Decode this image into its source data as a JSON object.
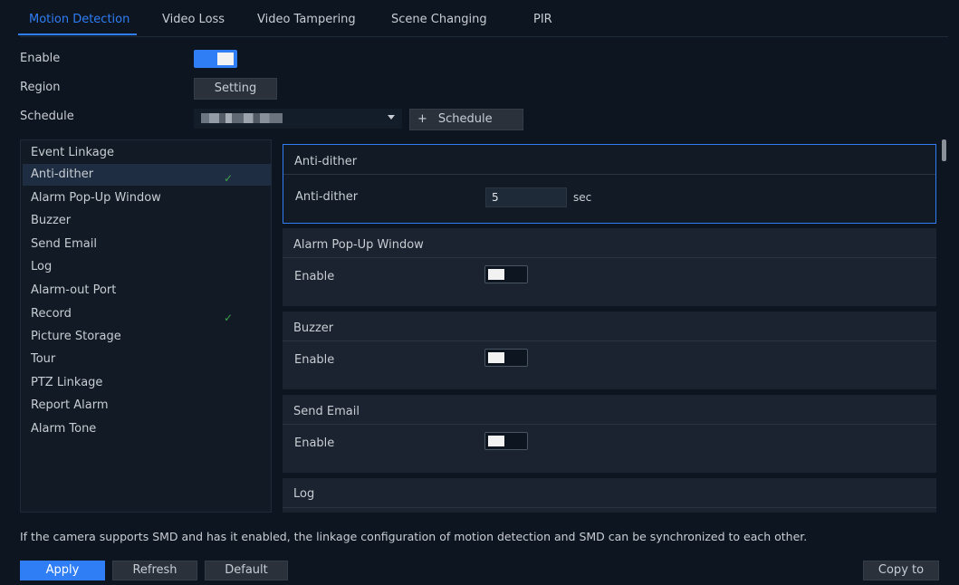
{
  "tabs": [
    {
      "label": "Motion Detection"
    },
    {
      "label": "Video Loss"
    },
    {
      "label": "Video Tampering"
    },
    {
      "label": "Scene Changing"
    },
    {
      "label": "PIR"
    }
  ],
  "settings": {
    "enable_label": "Enable",
    "enable_state": "on",
    "region_label": "Region",
    "region_button": "Setting",
    "schedule_label": "Schedule",
    "schedule_add_icon": "+",
    "schedule_add_label": "Schedule"
  },
  "linkage": {
    "header": "Event Linkage",
    "items": [
      {
        "label": "Anti-dither",
        "checked": true,
        "selected": true
      },
      {
        "label": "Alarm Pop-Up Window",
        "checked": false
      },
      {
        "label": "Buzzer",
        "checked": false
      },
      {
        "label": "Send Email",
        "checked": false
      },
      {
        "label": "Log",
        "checked": false
      },
      {
        "label": "Alarm-out Port",
        "checked": false
      },
      {
        "label": "Record",
        "checked": true
      },
      {
        "label": "Picture Storage",
        "checked": false
      },
      {
        "label": "Tour",
        "checked": false
      },
      {
        "label": "PTZ Linkage",
        "checked": false
      },
      {
        "label": "Report Alarm",
        "checked": false
      },
      {
        "label": "Alarm Tone",
        "checked": false
      }
    ],
    "check_glyph": "✓"
  },
  "sections": {
    "anti_dither": {
      "title": "Anti-dither",
      "field_label": "Anti-dither",
      "value": "5",
      "unit": "sec"
    },
    "popup": {
      "title": "Alarm Pop-Up Window",
      "field_label": "Enable",
      "state": "off"
    },
    "buzzer": {
      "title": "Buzzer",
      "field_label": "Enable",
      "state": "off"
    },
    "email": {
      "title": "Send Email",
      "field_label": "Enable",
      "state": "off"
    },
    "log": {
      "title": "Log"
    }
  },
  "note": "If the camera supports SMD and has it enabled, the linkage configuration of motion detection and SMD can be synchronized to each other.",
  "footer": {
    "apply": "Apply",
    "refresh": "Refresh",
    "default": "Default",
    "copy_to": "Copy to"
  },
  "colors": {
    "accent": "#2f7ef5",
    "background": "#0d1520",
    "check": "#3fa34a"
  }
}
